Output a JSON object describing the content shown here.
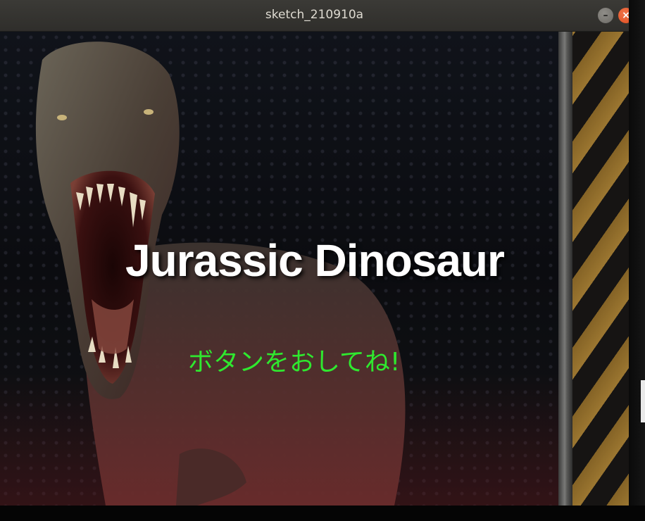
{
  "window": {
    "title": "sketch_210910a",
    "minimize_symbol": "–",
    "close_symbol": "×"
  },
  "canvas": {
    "headline": "Jurassic Dinosaur",
    "prompt": "ボタンをおしてね!",
    "prompt_color": "#2fe82f",
    "headline_color": "#ffffff",
    "hazard_colors": [
      "#c48a1d",
      "#1a1816"
    ]
  }
}
